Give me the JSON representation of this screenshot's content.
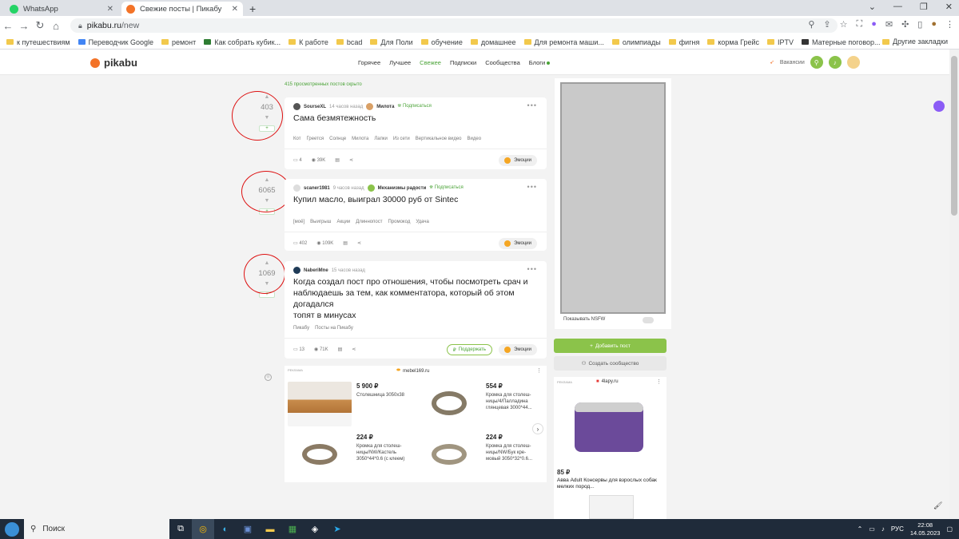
{
  "browser": {
    "tabs": [
      {
        "title": "WhatsApp",
        "color": "#25d366"
      },
      {
        "title": "Свежие посты | Пикабу",
        "color": "#f37328"
      }
    ],
    "url_host": "pikabu.ru",
    "url_path": "/new",
    "bookmarks": [
      "к путешествиям",
      "Переводчик Google",
      "ремонт",
      "Как собрать кубик...",
      "К работе",
      "bcad",
      "Для Поли",
      "обучение",
      "домашнее",
      "Для ремонта маши...",
      "олимпиады",
      "фигня",
      "корма Грейс",
      "IPTV",
      "Матерные поговор..."
    ],
    "other_bookmarks": "Другие закладки"
  },
  "header": {
    "logo": "pikabu",
    "nav": [
      "Горячее",
      "Лучшее",
      "Свежее",
      "Подписки",
      "Сообщества",
      "Блоги"
    ],
    "active_nav": "Свежее",
    "vacancies": "Вакансии"
  },
  "feed": {
    "hidden_note": "415 просмотренных постов скрыто",
    "posts": [
      {
        "rating": "403",
        "author": "SourseXL",
        "time": "14 часов назад",
        "community": "Милота",
        "subscribe": "Подписаться",
        "title": "Сама безмятежность",
        "tags": [
          "Кот",
          "Греется",
          "Солнце",
          "Милота",
          "Лапки",
          "Из сети",
          "Вертикальное видео",
          "Видео"
        ],
        "comments": "4",
        "views": "39K",
        "emotions": "Эмоции"
      },
      {
        "rating": "6065",
        "author": "scaner1981",
        "time": "9 часов назад",
        "community": "Механизмы радости",
        "subscribe": "Подписаться",
        "title": "Купил масло, выиграл 30000 руб от Sintec",
        "tags": [
          "[моё]",
          "Выигрыш",
          "Акции",
          "Длиннопост",
          "Промокод",
          "Удача"
        ],
        "comments": "402",
        "views": "109K",
        "emotions": "Эмоции"
      },
      {
        "rating": "1069",
        "author": "NaberiMne",
        "time": "15 часов назад",
        "title_lines": [
          "Когда создал пост про отношения, чтобы посмотреть срач и",
          "наблюдаешь за тем, как комментатора, который об этом догадался",
          "топят в минусах"
        ],
        "tags": [
          "Пикабу",
          "Посты на Пикабу"
        ],
        "comments": "13",
        "views": "71K",
        "support": "Поддержать",
        "emotions": "Эмоции"
      }
    ]
  },
  "ad_main": {
    "label": "РЕКЛАМА",
    "site": "mebel169.ru",
    "products": [
      {
        "price": "5 900 ₽",
        "name": "Столешница 3050x38"
      },
      {
        "price": "554 ₽",
        "name": "Кромка для столеш- ницы/4/Палладина глянцевая 3000*44..."
      },
      {
        "price": "224 ₽",
        "name": "Кромка для столеш- ницы/NW/Кастель 3050*44*0.6 (с клеем)"
      },
      {
        "price": "224 ₽",
        "name": "Кромка для столеш- ницы/NW/Бук кре- мовый 3050*32*0.6..."
      }
    ]
  },
  "sidebar": {
    "nsfw": "Показывать NSFW",
    "add_post": "Добавить пост",
    "create_community": "Создать сообщество",
    "ad": {
      "label": "РЕКЛАМА",
      "site": "4lapy.ru",
      "price": "85 ₽",
      "name": "Авва Adult Консервы для взрослых собак мелких пород..."
    }
  },
  "taskbar": {
    "search": "Поиск",
    "lang": "РУС",
    "time": "22:08",
    "date": "14.05.2023"
  }
}
